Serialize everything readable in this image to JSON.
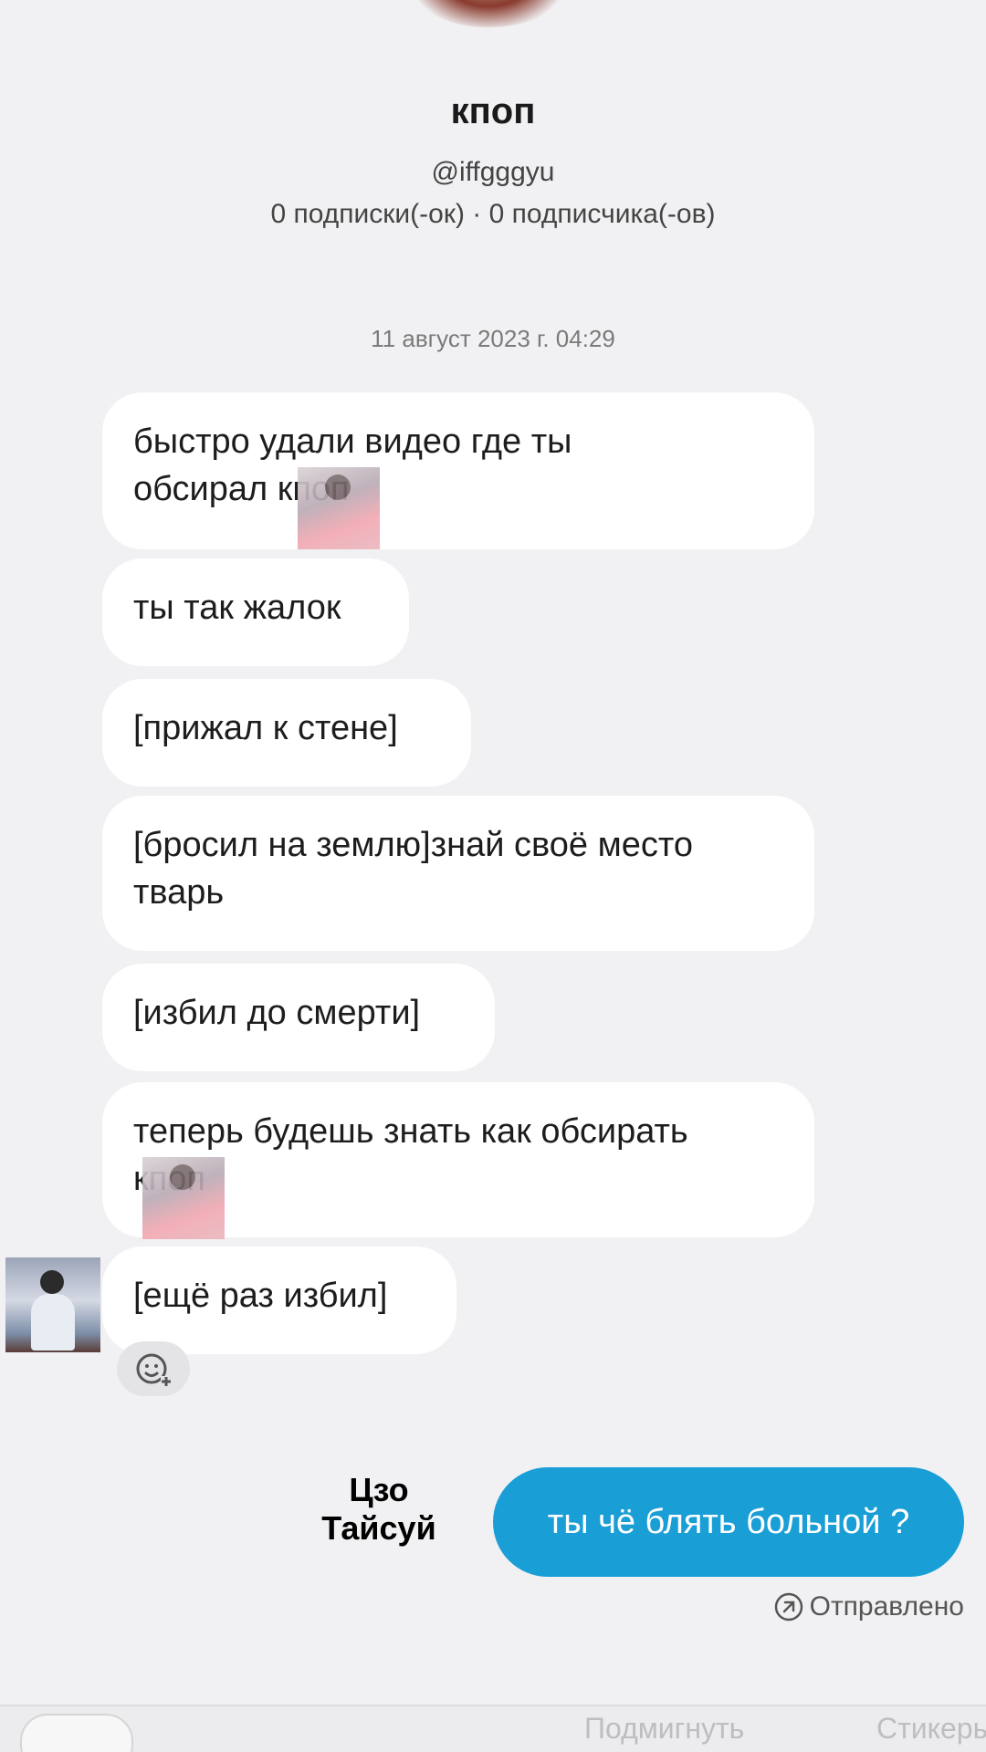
{
  "profile": {
    "name": "кпоп",
    "handle": "@iffgggyu",
    "stats": "0 подписки(-ок) · 0 подписчика(-ов)"
  },
  "chat": {
    "timestamp": "11 август 2023 г. 04:29",
    "messages": [
      {
        "line1": "быстро удали видео где ты",
        "line2": "обсирал кпоп"
      },
      {
        "text": "ты так жалок"
      },
      {
        "text": "[прижал к стене]"
      },
      {
        "line1": "[бросил на землю]знай своё место",
        "line2": "тварь"
      },
      {
        "text": "[избил до смерти]"
      },
      {
        "line1": "теперь будешь знать как обсирать",
        "line2": "кпоп"
      },
      {
        "text": "[ещё раз избил]"
      }
    ],
    "sent_message": "ты чё блять больной ?",
    "sent_status": "Отправлено"
  },
  "overlay_caption": {
    "line1": "Цзо",
    "line2": "Тайсуй"
  },
  "bottom_bar": {
    "hint_center": "Подмигнуть",
    "hint_right": "Стикеры"
  },
  "colors": {
    "sent_bubble": "#1a9ed6",
    "background": "#f1f1f3",
    "received_bubble": "#ffffff"
  },
  "icons": [
    "sticker-icon",
    "add-reaction-icon",
    "sent-status-icon"
  ]
}
